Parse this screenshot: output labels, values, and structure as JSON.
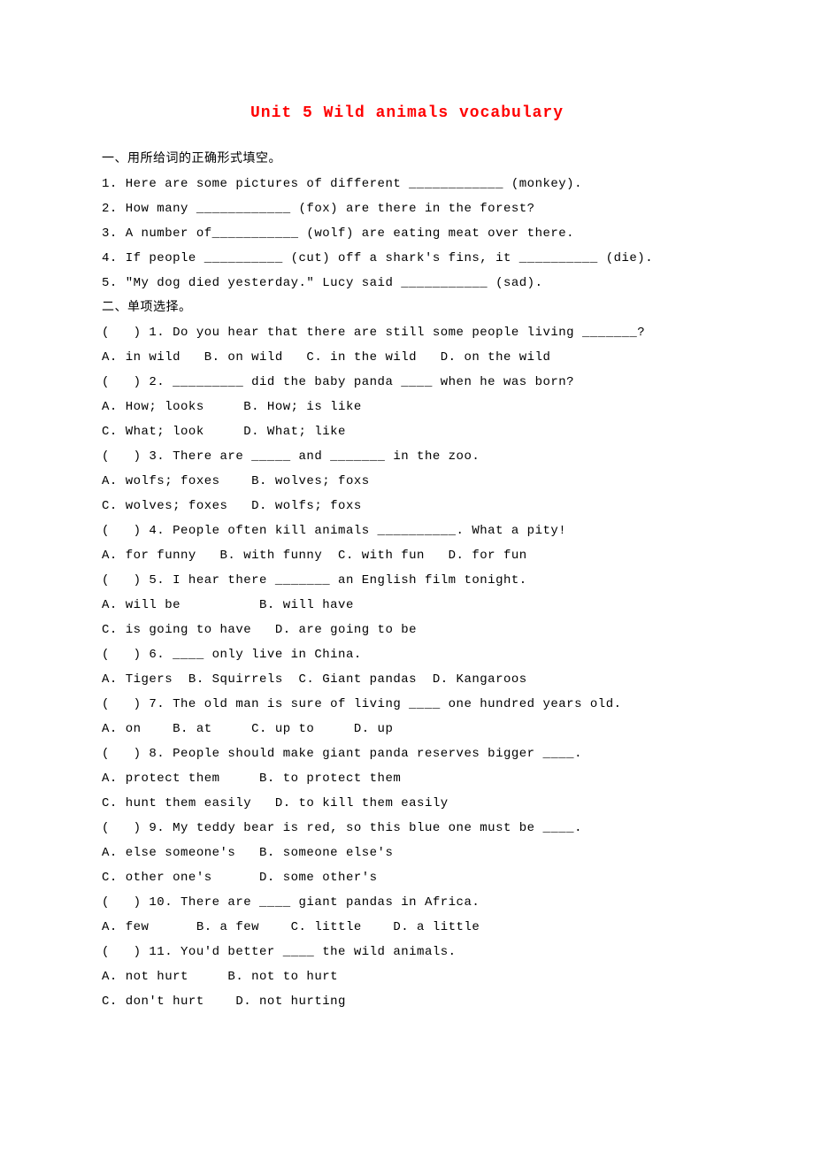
{
  "title": "Unit 5 Wild animals vocabulary",
  "section1": {
    "header": "一、用所给词的正确形式填空。",
    "items": [
      "1. Here are some pictures of different ____________ (monkey).",
      "2. How many ____________ (fox) are there in the forest?",
      "3. A number of___________ (wolf) are eating meat over there.",
      "4. If people __________ (cut) off a shark's fins, it __________ (die).",
      "5. \"My dog died yesterday.\" Lucy said ___________ (sad)."
    ]
  },
  "section2": {
    "header": "二、单项选择。",
    "questions": [
      {
        "q": "(   ) 1. Do you hear that there are still some people living _______?",
        "opts": "A. in wild   B. on wild   C. in the wild   D. on the wild"
      },
      {
        "q": "(   ) 2. _________ did the baby panda ____ when he was born?",
        "opts": "A. How; looks     B. How; is like\nC. What; look     D. What; like"
      },
      {
        "q": "(   ) 3. There are _____ and _______ in the zoo.",
        "opts": "A. wolfs; foxes    B. wolves; foxs\nC. wolves; foxes   D. wolfs; foxs"
      },
      {
        "q": "(   ) 4. People often kill animals __________. What a pity!",
        "opts": "A. for funny   B. with funny  C. with fun   D. for fun"
      },
      {
        "q": "(   ) 5. I hear there _______ an English film tonight.",
        "opts": "A. will be          B. will have\nC. is going to have   D. are going to be"
      },
      {
        "q": "(   ) 6. ____ only live in China.",
        "opts": "A. Tigers  B. Squirrels  C. Giant pandas  D. Kangaroos"
      },
      {
        "q": "(   ) 7. The old man is sure of living ____ one hundred years old.",
        "opts": "A. on    B. at     C. up to     D. up"
      },
      {
        "q": "(   ) 8. People should make giant panda reserves bigger ____.",
        "opts": "A. protect them     B. to protect them\nC. hunt them easily   D. to kill them easily"
      },
      {
        "q": "(   ) 9. My teddy bear is red, so this blue one must be ____.",
        "opts": "A. else someone's   B. someone else's\nC. other one's      D. some other's"
      },
      {
        "q": "(   ) 10. There are ____ giant pandas in Africa.",
        "opts": "A. few      B. a few    C. little    D. a little"
      },
      {
        "q": "(   ) 11. You'd better ____ the wild animals.",
        "opts": "A. not hurt     B. not to hurt\nC. don't hurt    D. not hurting"
      }
    ]
  }
}
